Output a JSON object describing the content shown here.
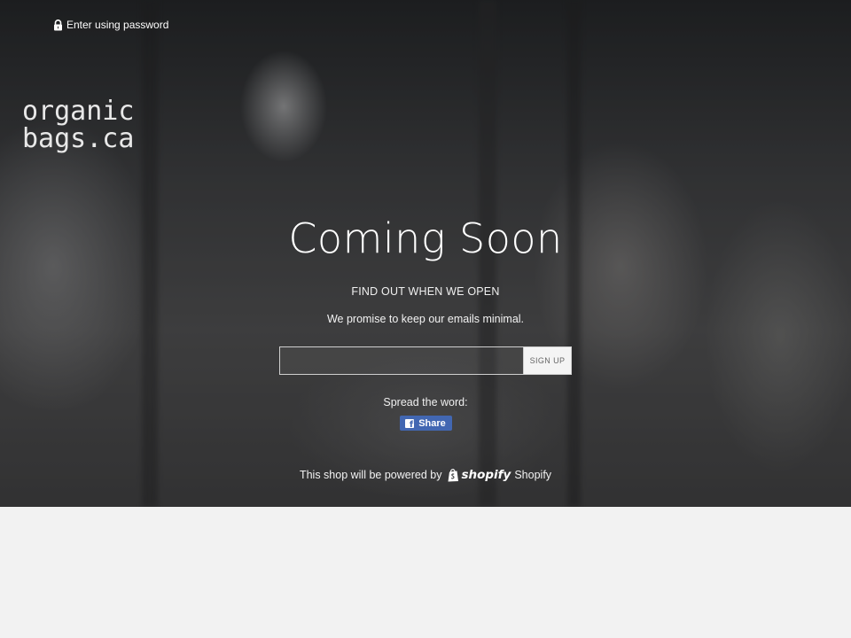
{
  "header": {
    "password_link": "Enter using password",
    "lock_icon": "lock-icon"
  },
  "logo": {
    "line1": "organic",
    "line2": "bags.ca"
  },
  "main": {
    "title": "Coming Soon",
    "subtitle": "FIND OUT WHEN WE OPEN",
    "description": "We promise to keep our emails minimal.",
    "email_placeholder": "",
    "signup_label": "SIGN UP",
    "spread_label": "Spread the word:",
    "share_label": "Share",
    "share_icon": "facebook-icon"
  },
  "footer": {
    "powered_text": "This shop will be powered by",
    "shopify_logo_text": "shopify",
    "shopify_link": "Shopify",
    "shopify_icon": "shopify-bag-icon"
  },
  "colors": {
    "facebook_blue": "#4267b2",
    "page_background": "#f2f2f2",
    "text": "#ffffff"
  }
}
